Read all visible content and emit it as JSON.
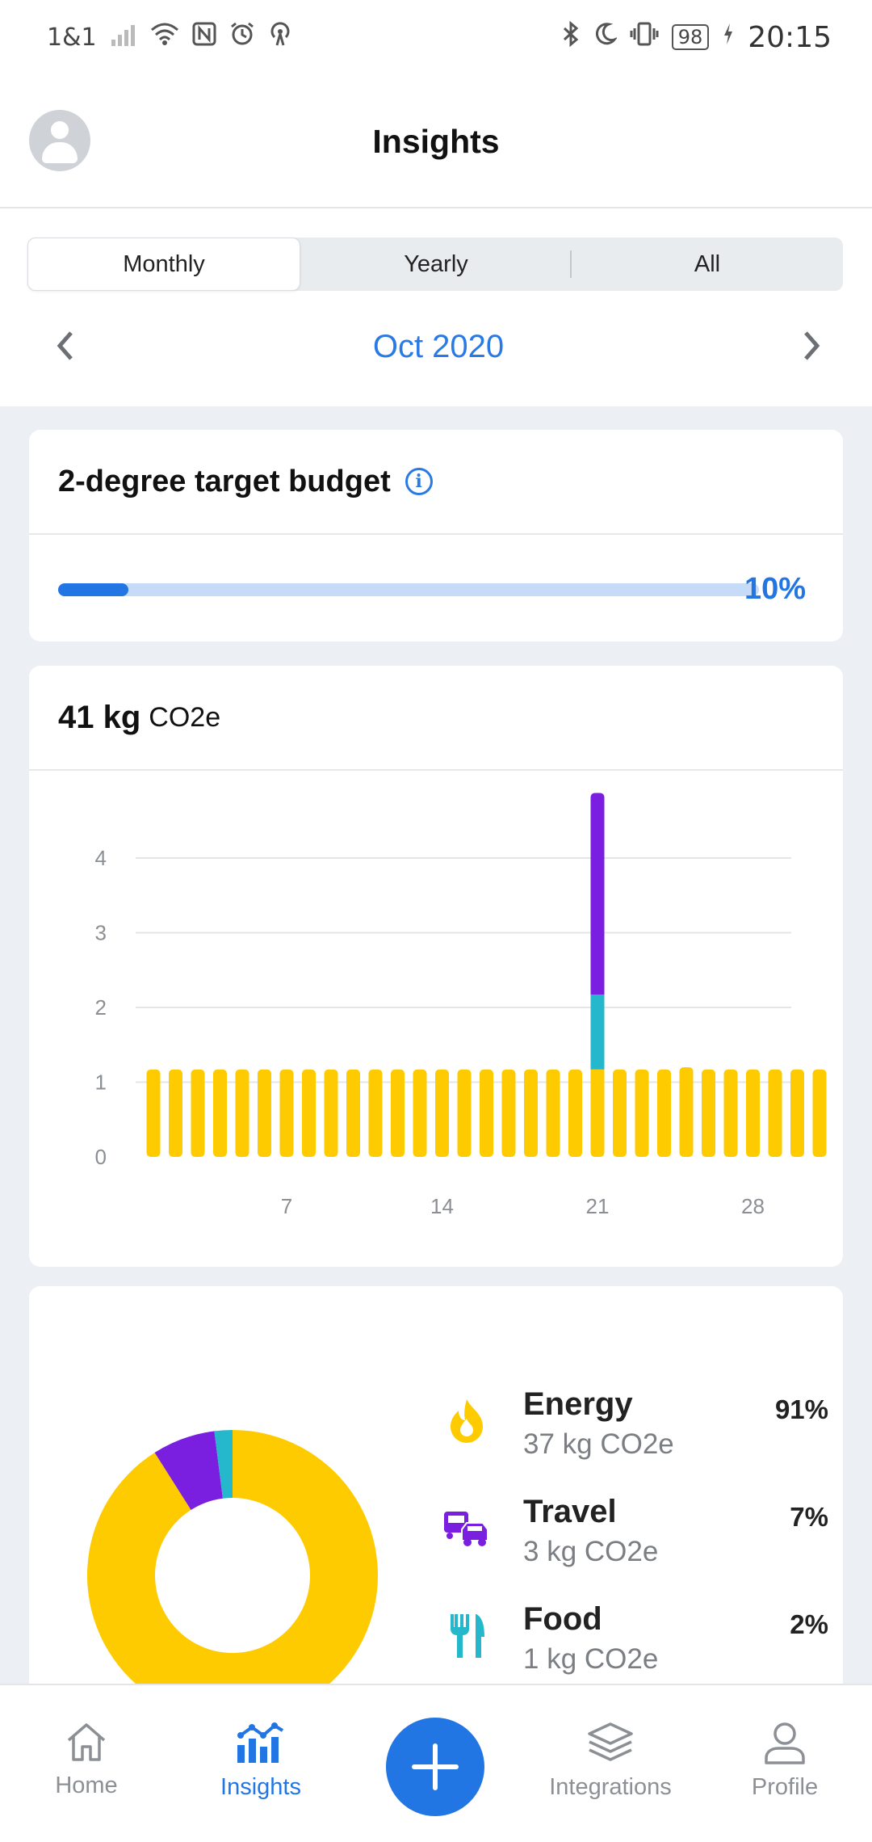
{
  "status_bar": {
    "carrier": "1&1",
    "battery": "98",
    "time": "20:15"
  },
  "header": {
    "title": "Insights"
  },
  "period_tabs": [
    {
      "label": "Monthly",
      "selected": true
    },
    {
      "label": "Yearly",
      "selected": false
    },
    {
      "label": "All",
      "selected": false
    }
  ],
  "month_nav": {
    "label": "Oct 2020"
  },
  "budget": {
    "title": "2-degree target budget",
    "percent_label": "10%",
    "progress": 0.1
  },
  "emissions": {
    "total_value": "41 kg",
    "total_unit": "CO2e"
  },
  "chart_data": {
    "type": "bar",
    "stacked": true,
    "x": [
      1,
      2,
      3,
      4,
      5,
      6,
      7,
      8,
      9,
      10,
      11,
      12,
      13,
      14,
      15,
      16,
      17,
      18,
      19,
      20,
      21,
      22,
      23,
      24,
      25,
      26,
      27,
      28,
      29,
      30,
      31
    ],
    "x_tick_labels": [
      "7",
      "14",
      "21",
      "28"
    ],
    "x_ticks": [
      7,
      14,
      21,
      28
    ],
    "y_tick_labels": [
      "0",
      "1",
      "2",
      "3",
      "4"
    ],
    "y_ticks": [
      0,
      1,
      2,
      3,
      4
    ],
    "ylim": [
      0,
      5
    ],
    "grid": true,
    "series": [
      {
        "key": "energy",
        "color": "#fdcb00",
        "values": [
          1.17,
          1.17,
          1.17,
          1.17,
          1.17,
          1.17,
          1.17,
          1.17,
          1.17,
          1.17,
          1.17,
          1.17,
          1.17,
          1.17,
          1.17,
          1.17,
          1.17,
          1.17,
          1.17,
          1.17,
          1.17,
          1.17,
          1.17,
          1.17,
          1.2,
          1.17,
          1.17,
          1.17,
          1.17,
          1.17,
          1.17
        ]
      },
      {
        "key": "food",
        "color": "#25b8cc",
        "values": [
          0,
          0,
          0,
          0,
          0,
          0,
          0,
          0,
          0,
          0,
          0,
          0,
          0,
          0,
          0,
          0,
          0,
          0,
          0,
          0,
          1.0,
          0,
          0,
          0,
          0,
          0,
          0,
          0,
          0,
          0,
          0
        ]
      },
      {
        "key": "travel",
        "color": "#7a1fe0",
        "values": [
          0,
          0,
          0,
          0,
          0,
          0,
          0,
          0,
          0,
          0,
          0,
          0,
          0,
          0,
          0,
          0,
          0,
          0,
          0,
          0,
          2.7,
          0,
          0,
          0,
          0,
          0,
          0,
          0,
          0,
          0,
          0
        ]
      }
    ]
  },
  "breakdown": {
    "items": [
      {
        "name": "Energy",
        "amount": "37 kg CO2e",
        "percent": "91%",
        "value": 91,
        "color": "#fdcb00",
        "icon": "flame-icon"
      },
      {
        "name": "Travel",
        "amount": "3 kg CO2e",
        "percent": "7%",
        "value": 7,
        "color": "#7a1fe0",
        "icon": "vehicles-icon"
      },
      {
        "name": "Food",
        "amount": "1 kg CO2e",
        "percent": "2%",
        "value": 2,
        "color": "#25b8cc",
        "icon": "cutlery-icon"
      }
    ]
  },
  "bottom_nav": {
    "items": [
      {
        "label": "Home",
        "icon": "home-icon",
        "active": false
      },
      {
        "label": "Insights",
        "icon": "insights-icon",
        "active": true
      },
      {
        "label": "Integrations",
        "icon": "layers-icon",
        "active": false
      },
      {
        "label": "Profile",
        "icon": "person-icon",
        "active": false
      }
    ],
    "fab_icon": "plus-icon"
  },
  "colors": {
    "accent": "#2276e4",
    "progress_track": "#c5dbf7"
  }
}
